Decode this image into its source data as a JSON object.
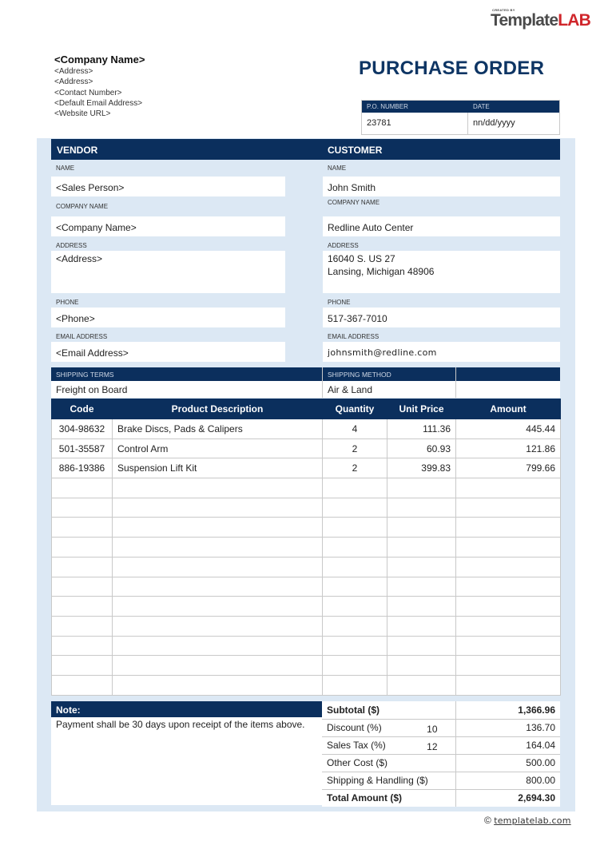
{
  "brand": {
    "created_by": "CREATED BY",
    "name_part1": "Template",
    "name_part2": "LAB"
  },
  "company": {
    "name": "<Company Name>",
    "lines": [
      "<Address>",
      "<Address>",
      "<Contact Number>",
      "<Default Email Address>",
      "<Website URL>"
    ]
  },
  "title": "PURCHASE ORDER",
  "po": {
    "number_label": "P.O. NUMBER",
    "number": "23781",
    "date_label": "DATE",
    "date": "nn/dd/yyyy"
  },
  "vendor": {
    "header": "VENDOR",
    "name_label": "NAME",
    "name": "<Sales Person>",
    "company_label": "COMPANY NAME",
    "company": "<Company Name>",
    "address_label": "ADDRESS",
    "address": [
      "<Address>",
      ""
    ],
    "phone_label": "PHONE",
    "phone": "<Phone>",
    "email_label": "EMAIL ADDRESS",
    "email": "<Email Address>"
  },
  "customer": {
    "header": "CUSTOMER",
    "name_label": "NAME",
    "name": "John Smith",
    "company_label": "COMPANY NAME",
    "company": "Redline Auto Center",
    "address_label": "ADDRESS",
    "address": [
      "16040 S. US 27",
      "Lansing, Michigan 48906"
    ],
    "phone_label": "PHONE",
    "phone": "517-367-7010",
    "email_label": "EMAIL ADDRESS",
    "email": "johnsmith@redline.com"
  },
  "shipping": {
    "terms_label": "SHIPPING TERMS",
    "terms": "Freight on Board",
    "method_label": "SHIPPING METHOD",
    "method": "Air & Land"
  },
  "items": {
    "columns": [
      "Code",
      "Product Description",
      "Quantity",
      "Unit Price",
      "Amount"
    ],
    "rows": [
      [
        "304-98632",
        "Brake Discs, Pads & Calipers",
        "4",
        "111.36",
        "445.44"
      ],
      [
        "501-35587",
        "Control Arm",
        "2",
        "60.93",
        "121.86"
      ],
      [
        "886-19386",
        "Suspension Lift Kit",
        "2",
        "399.83",
        "799.66"
      ],
      [
        "",
        "",
        "",
        "",
        ""
      ],
      [
        "",
        "",
        "",
        "",
        ""
      ],
      [
        "",
        "",
        "",
        "",
        ""
      ],
      [
        "",
        "",
        "",
        "",
        ""
      ],
      [
        "",
        "",
        "",
        "",
        ""
      ],
      [
        "",
        "",
        "",
        "",
        ""
      ],
      [
        "",
        "",
        "",
        "",
        ""
      ],
      [
        "",
        "",
        "",
        "",
        ""
      ],
      [
        "",
        "",
        "",
        "",
        ""
      ],
      [
        "",
        "",
        "",
        "",
        ""
      ],
      [
        "",
        "",
        "",
        "",
        ""
      ]
    ]
  },
  "note": {
    "label": "Note:",
    "text": "Payment shall be 30 days upon receipt of the items above."
  },
  "totals": [
    {
      "label": "Subtotal ($)",
      "pct": "",
      "value": "1,366.96",
      "bold": true
    },
    {
      "label": "Discount (%)",
      "pct": "10",
      "value": "136.70",
      "bold": false
    },
    {
      "label": "Sales Tax (%)",
      "pct": "12",
      "value": "164.04",
      "bold": false
    },
    {
      "label": "Other Cost ($)",
      "pct": "",
      "value": "500.00",
      "bold": false
    },
    {
      "label": "Shipping & Handling ($)",
      "pct": "",
      "value": "800.00",
      "bold": false
    },
    {
      "label": "Total Amount ($)",
      "pct": "",
      "value": "2,694.30",
      "bold": true
    }
  ],
  "footer": {
    "copyright_symbol": "©",
    "url": "templatelab.com"
  },
  "colors": {
    "navy": "#0b2f5d",
    "title": "#0e3564",
    "panel": "#dce8f4",
    "brand_red": "#d0262b"
  }
}
